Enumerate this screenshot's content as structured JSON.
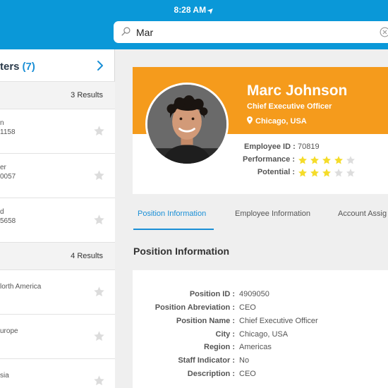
{
  "status_bar": {
    "time": "8:28 AM",
    "location_arrow": "➤"
  },
  "search": {
    "value": "Mar",
    "icon": "search-icon"
  },
  "left_panel": {
    "title": "ters",
    "count": "(7)",
    "sections": [
      {
        "results": "3 Results",
        "items": [
          {
            "line1": "n",
            "line2": "1158"
          },
          {
            "line1": "er",
            "line2": "0057"
          },
          {
            "line1": "d",
            "line2": "5658"
          }
        ]
      },
      {
        "results": "4 Results",
        "items": [
          {
            "line1": "lorth America",
            "line2": ""
          },
          {
            "line1": "urope",
            "line2": ""
          },
          {
            "line1": "sia",
            "line2": ""
          }
        ]
      }
    ]
  },
  "profile": {
    "name": "Marc Johnson",
    "title": "Chief Executive Officer",
    "location": "Chicago, USA",
    "employee_id_label": "Employee ID :",
    "employee_id": "70819",
    "performance_label": "Performance :",
    "performance_rating": 4,
    "potential_label": "Potential :",
    "potential_rating": 3,
    "max_rating": 5
  },
  "tabs": [
    {
      "label": "Position Information",
      "active": true
    },
    {
      "label": "Employee Information",
      "active": false
    },
    {
      "label": "Account Assig",
      "active": false
    }
  ],
  "position_section": {
    "title": "Position Information",
    "fields": [
      {
        "label": "Position ID :",
        "value": "4909050"
      },
      {
        "label": "Position Abreviation :",
        "value": "CEO"
      },
      {
        "label": "Position Name :",
        "value": "Chief Executive Officer"
      },
      {
        "label": "City :",
        "value": "Chicago, USA"
      },
      {
        "label": "Region :",
        "value": "Americas"
      },
      {
        "label": "Staff Indicator :",
        "value": "No"
      },
      {
        "label": "Description :",
        "value": "CEO"
      }
    ]
  },
  "colors": {
    "header_blue": "#0a98d8",
    "accent_blue": "#1a8fd6",
    "banner_orange": "#f59b1c",
    "star_filled": "#f5dc2a",
    "star_empty": "#dddddd"
  }
}
